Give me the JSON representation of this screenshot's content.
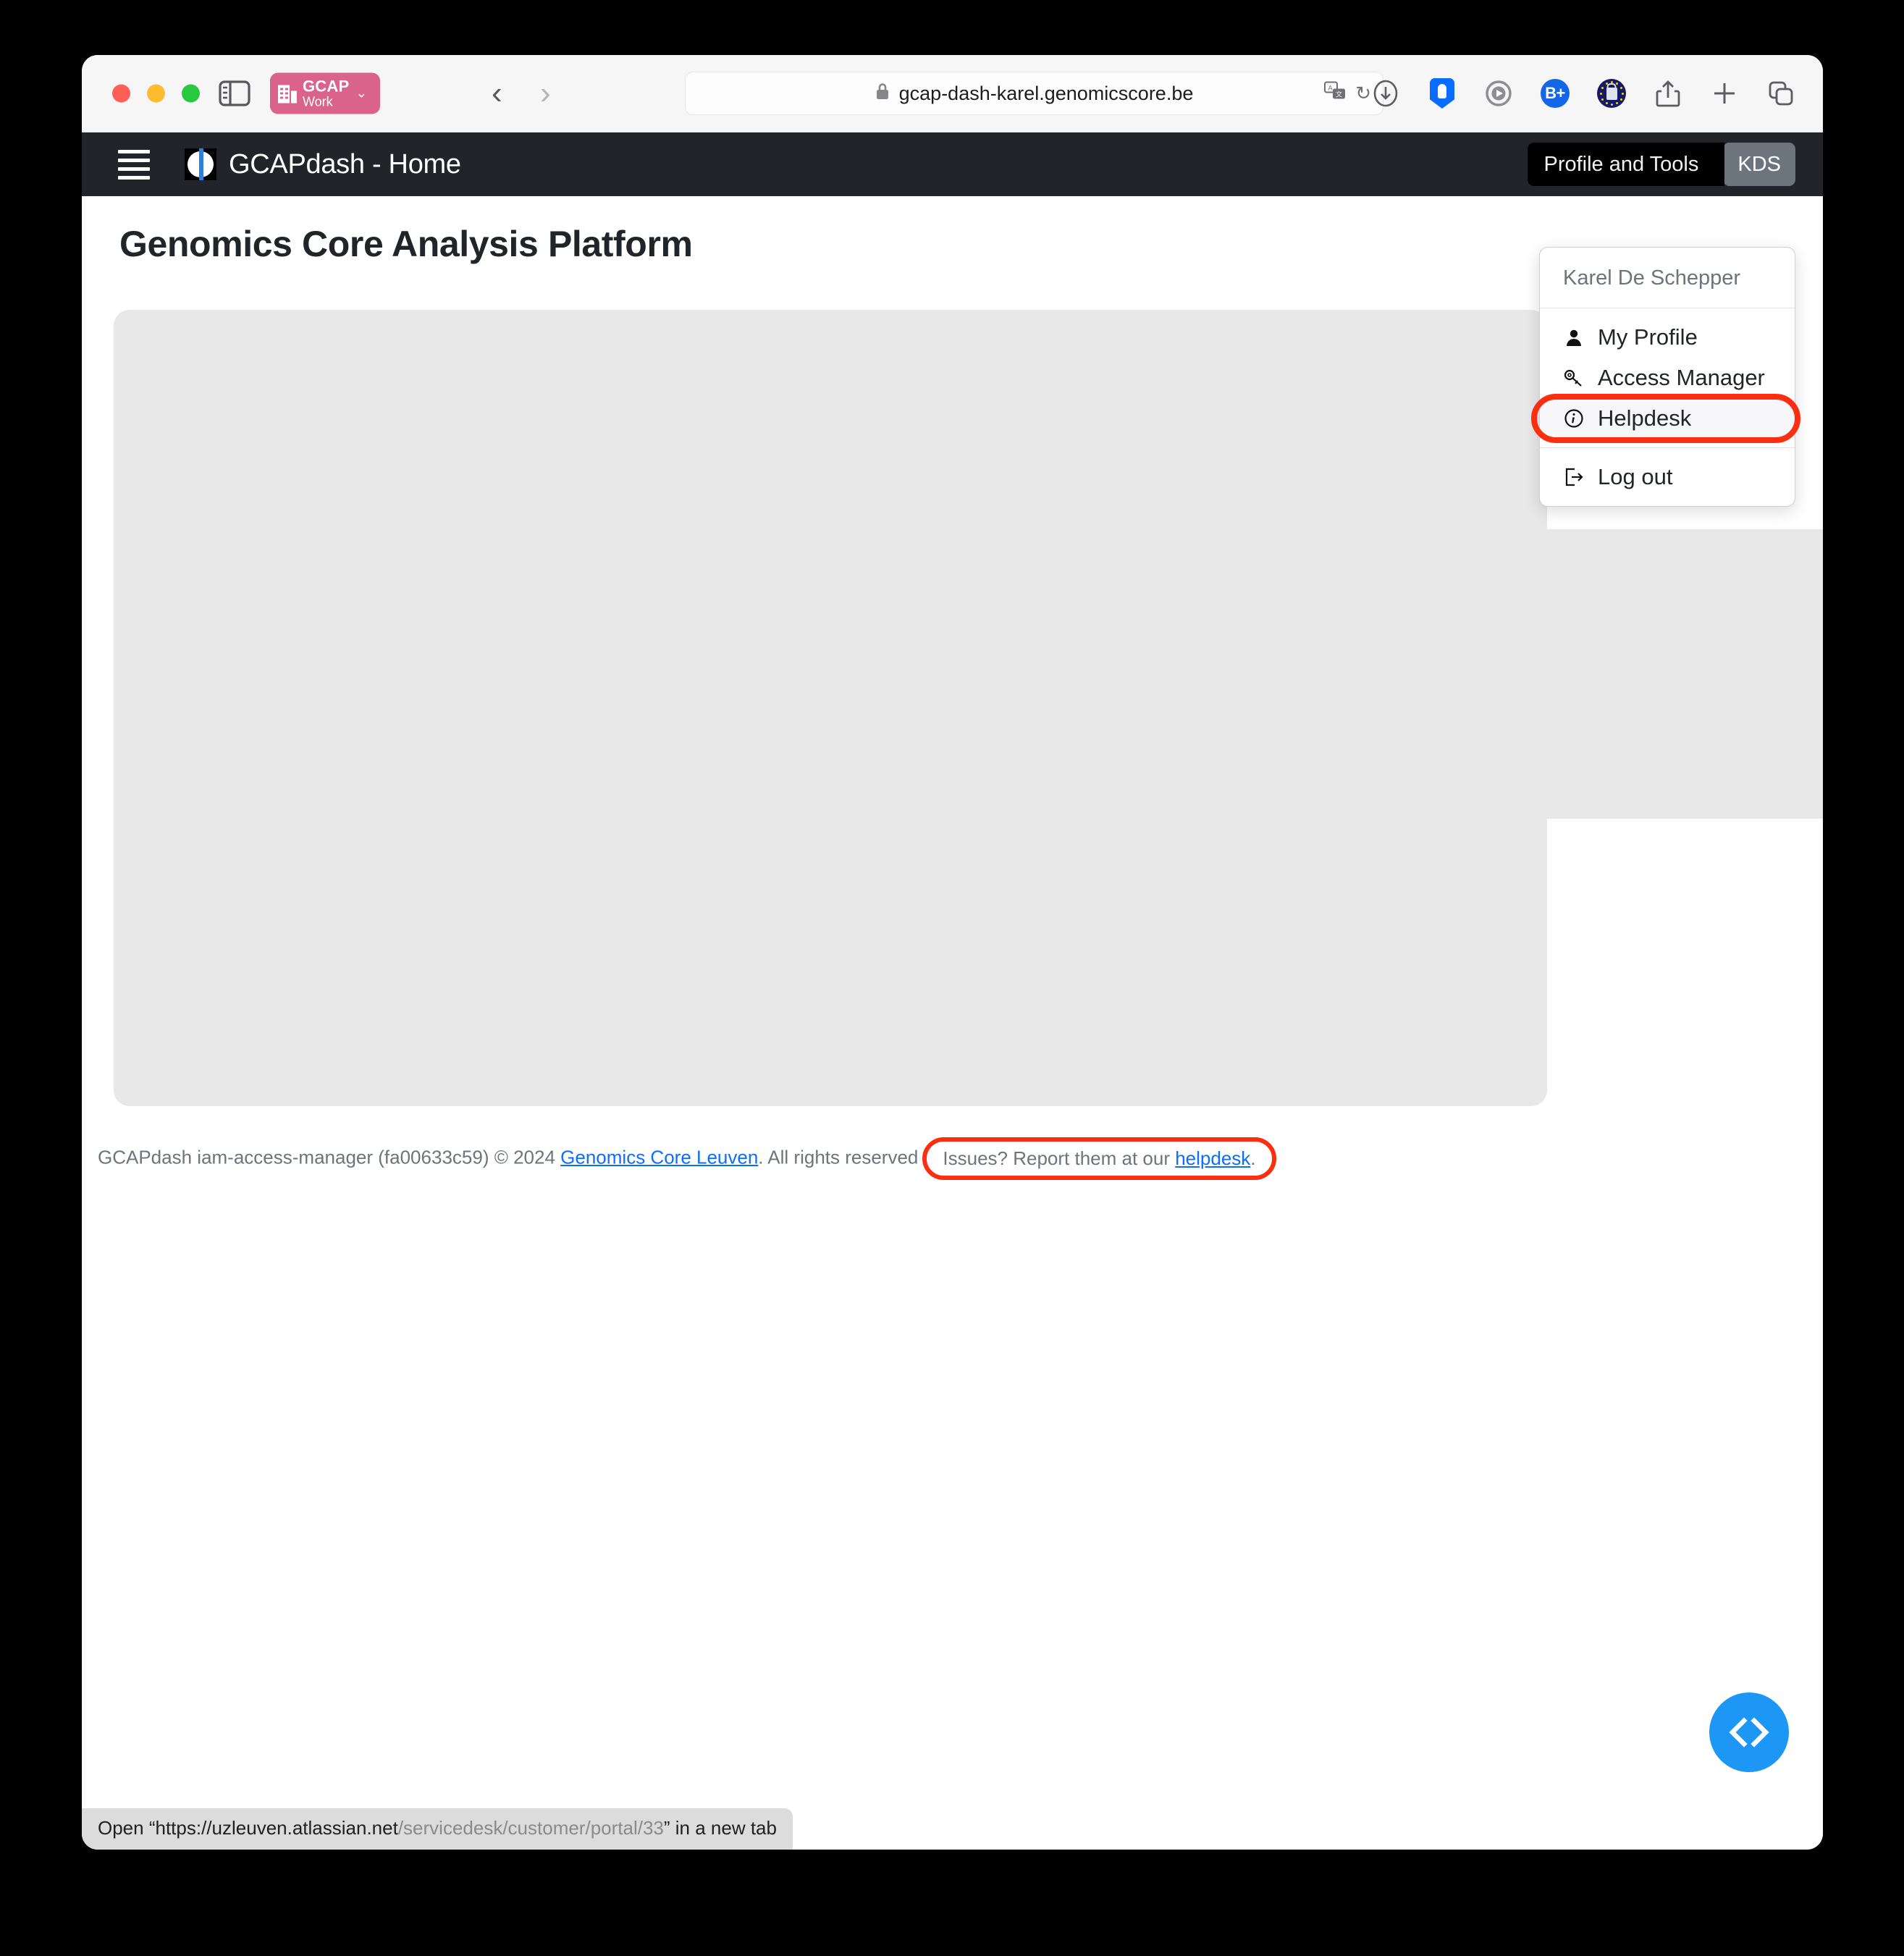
{
  "browser": {
    "traffic_lights": [
      "close",
      "minimize",
      "zoom"
    ],
    "sidebar_icon": "sidebar-icon",
    "profile_chip": {
      "name": "GCAP",
      "sub": "Work",
      "chevron": "⌄"
    },
    "nav": {
      "back": "‹",
      "forward": "›"
    },
    "url": {
      "lock": "🔒",
      "text": "gcap-dash-karel.genomicscore.be",
      "translate_icon": "translate-icon",
      "reload_icon": "↻"
    },
    "toolbar_icons": [
      {
        "name": "downloads-icon",
        "glyph": "↓"
      },
      {
        "name": "password-manager-icon",
        "glyph": ""
      },
      {
        "name": "recording-icon",
        "glyph": "▶"
      },
      {
        "name": "bitwarden-icon",
        "glyph": "B+"
      },
      {
        "name": "eu-privacy-icon",
        "glyph": ""
      },
      {
        "name": "share-icon",
        "glyph": "⇧"
      },
      {
        "name": "new-tab-icon",
        "glyph": "+"
      },
      {
        "name": "tab-overview-icon",
        "glyph": "⧉"
      }
    ]
  },
  "app_header": {
    "menu_icon": "hamburger-icon",
    "logo": "gcap-logo",
    "title": "GCAPdash - Home",
    "profile_tools_label": "Profile and Tools",
    "user_initials": "KDS"
  },
  "page": {
    "title": "Genomics Core Analysis Platform"
  },
  "dropdown": {
    "user_name": "Karel De Schepper",
    "items": [
      {
        "label": "My Profile",
        "icon": "user-icon",
        "glyph": "👤",
        "highlighted": false
      },
      {
        "label": "Access Manager",
        "icon": "key-icon",
        "glyph": "⚷",
        "highlighted": false
      },
      {
        "label": "Helpdesk",
        "icon": "info-circle-icon",
        "glyph": "ⓘ",
        "highlighted": true
      }
    ],
    "logout": {
      "label": "Log out",
      "icon": "logout-icon",
      "glyph": "↪"
    }
  },
  "footer": {
    "app": "GCAPdash iam-access-manager (fa00633c59) © 2024 ",
    "org_link": "Genomics Core Leuven",
    "rights": ". All rights reserved",
    "issues_prefix": "Issues? Report them at our ",
    "helpdesk_link": "helpdesk",
    "issues_suffix": "."
  },
  "fab": {
    "label": "‹›",
    "icon": "code-brackets-icon"
  },
  "status_bar": {
    "prefix": "Open “",
    "domain": "https://uzleuven.atlassian.net",
    "path": "/servicedesk/customer/portal/33",
    "suffix": "” in a new tab"
  },
  "colors": {
    "header_bg": "#212529",
    "accent_blue": "#0d6efd",
    "highlight_red": "#fb2e11",
    "fab_blue": "#1d97f5",
    "card_gray": "#e8e8e8",
    "chip_pink": "#d9638b"
  }
}
